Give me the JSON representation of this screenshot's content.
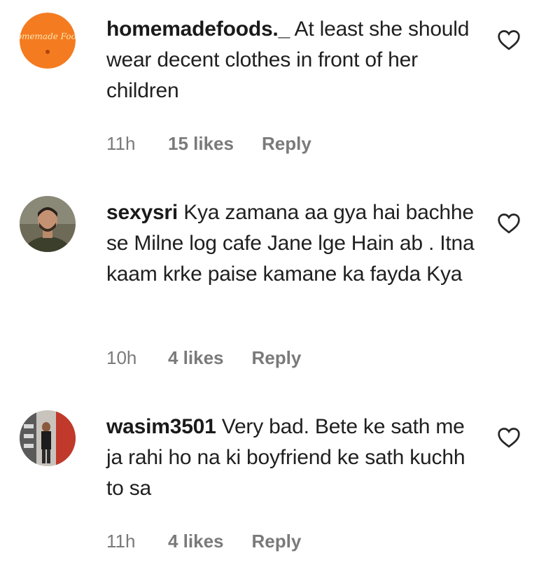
{
  "comments": [
    {
      "username": "homemadefoods._",
      "text": "At least she should wear decent clothes in front of her children",
      "time": "11h",
      "likes": "15 likes",
      "reply": "Reply",
      "avatar_text": "Homemade Foods",
      "avatar_color": "#f47b20"
    },
    {
      "username": "sexysri",
      "text": "Kya zamana aa gya hai bachhe se Milne log cafe Jane lge Hain ab . Itna kaam krke paise kamane ka fayda Kya",
      "time": "10h",
      "likes": "4 likes",
      "reply": "Reply"
    },
    {
      "username": "wasim3501",
      "text": "Very bad. Bete ke sath me ja rahi ho na ki boyfriend ke sath kuchh to sa",
      "time": "11h",
      "likes": "4 likes",
      "reply": "Reply"
    }
  ]
}
